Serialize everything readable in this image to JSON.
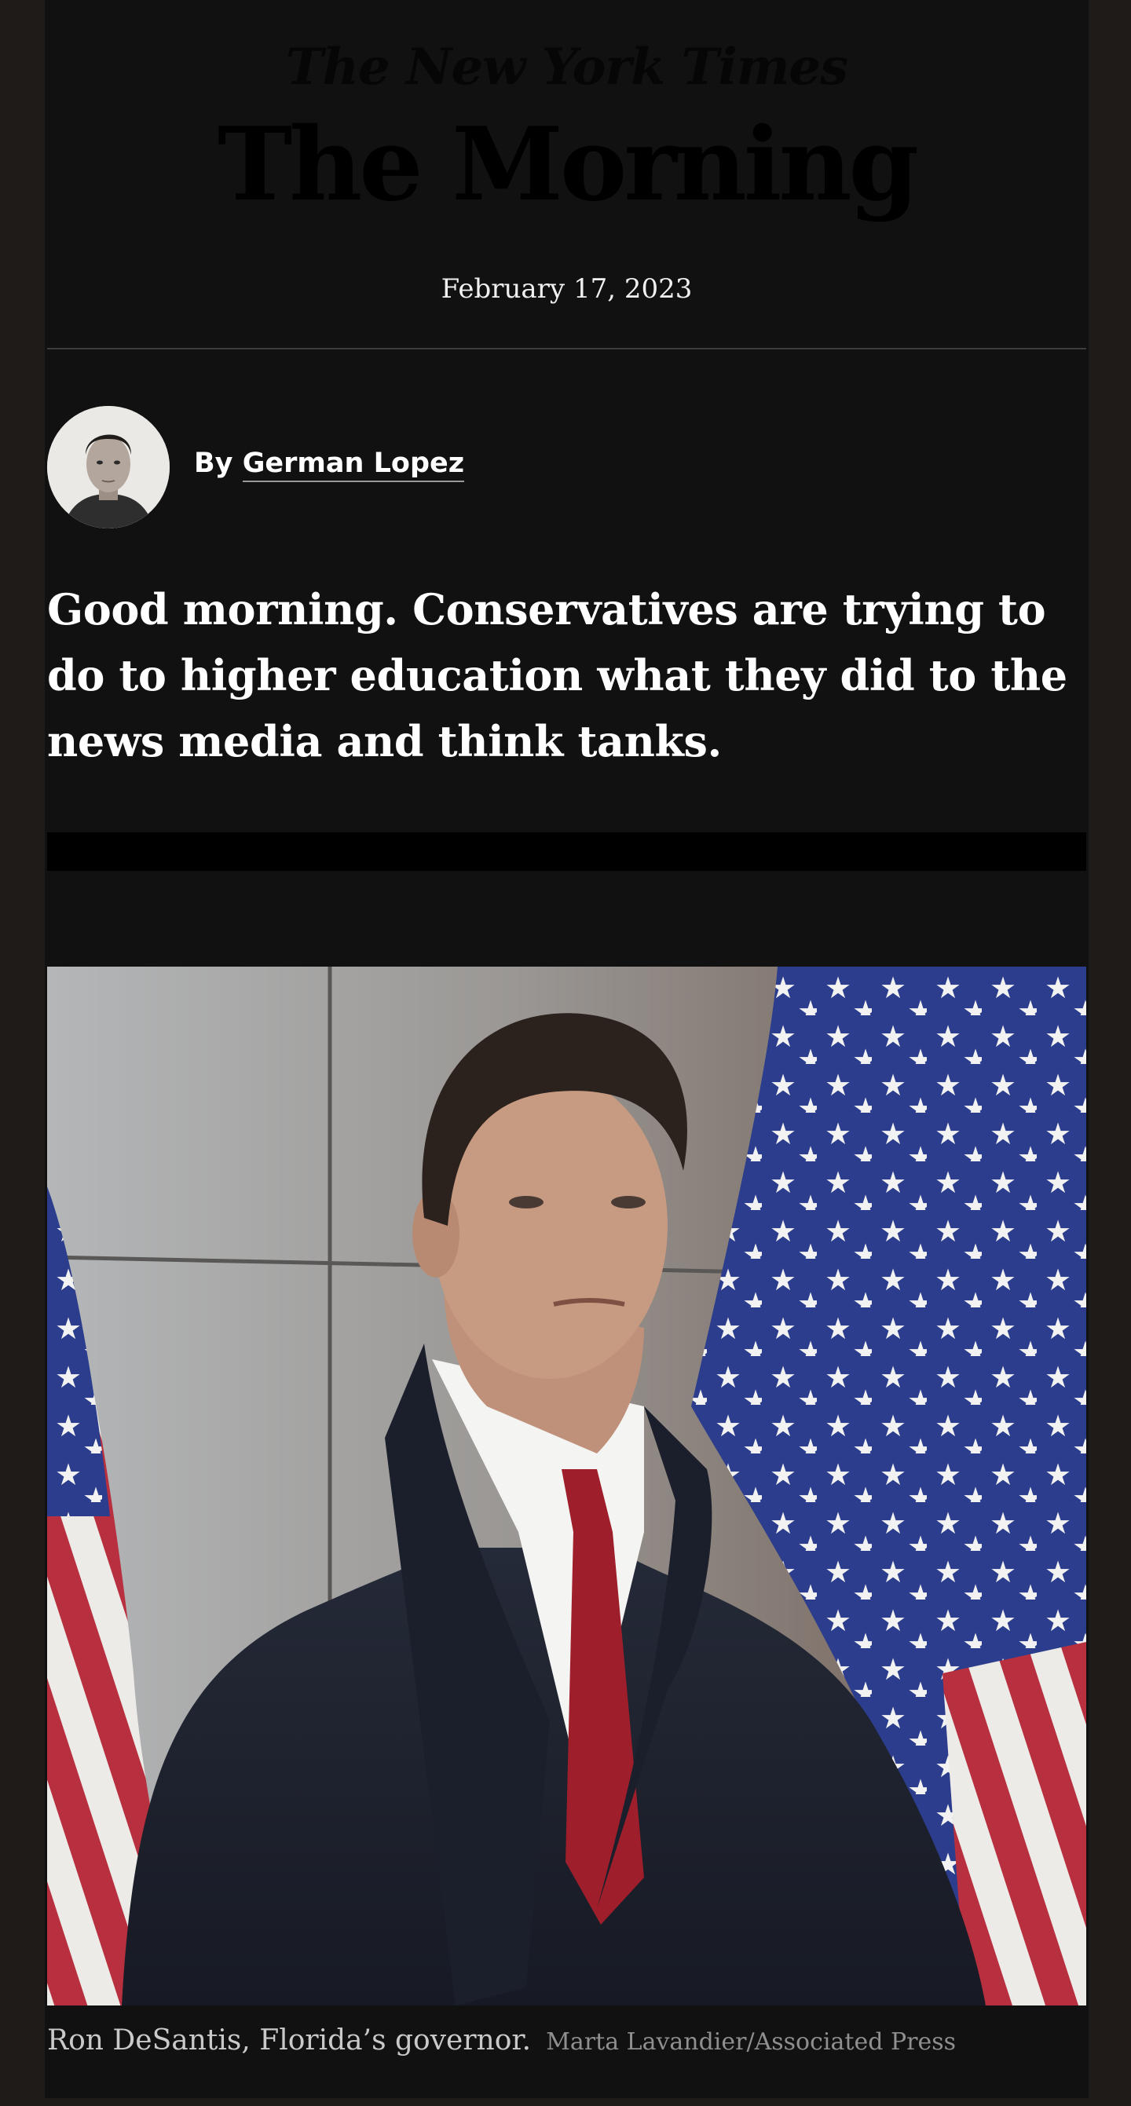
{
  "masthead": {
    "publication": "The New York Times",
    "newsletter": "The Morning"
  },
  "date": "February 17, 2023",
  "byline": {
    "prefix": "By",
    "author": "German Lopez"
  },
  "lede": "Good morning. Conservatives are trying to do to higher education what they did to the news media and think tanks.",
  "photo": {
    "caption": "Ron DeSantis, Florida’s governor.",
    "credit": "Marta Lavandier/Associated Press"
  },
  "colors": {
    "page_background": "#111111",
    "outer_background": "#1e1b18",
    "text": "#ffffff"
  }
}
